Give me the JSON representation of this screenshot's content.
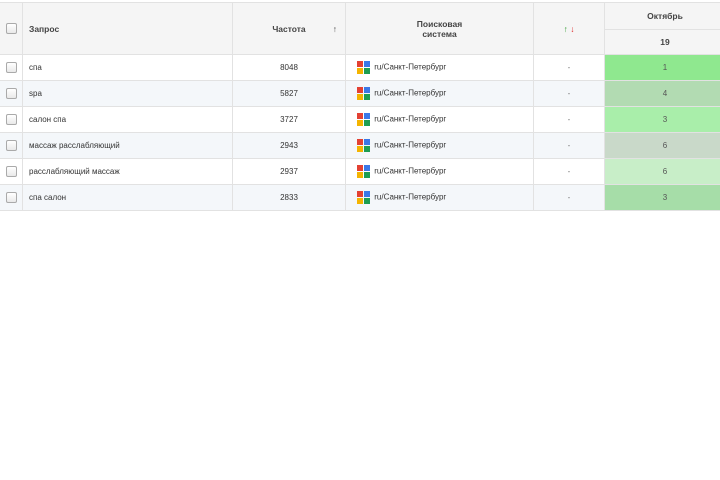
{
  "header": {
    "query": "Запрос",
    "frequency": "Частота",
    "sort_arrow": "↑",
    "engine_line1": "Поисковая",
    "engine_line2": "система",
    "dyn_up": "↑",
    "dyn_down": "↓",
    "month": "Октябрь",
    "day": "19"
  },
  "rows": [
    {
      "query": "спа",
      "frequency": "8048",
      "engine": "ru/Санкт-Петербург",
      "dynamics": "-",
      "position": "1",
      "pos_color": "#8fe88f"
    },
    {
      "query": "spa",
      "frequency": "5827",
      "engine": "ru/Санкт-Петербург",
      "dynamics": "-",
      "position": "4",
      "pos_color": "#b2dbb2"
    },
    {
      "query": "салон спа",
      "frequency": "3727",
      "engine": "ru/Санкт-Петербург",
      "dynamics": "-",
      "position": "3",
      "pos_color": "#a9eeaa"
    },
    {
      "query": "массаж расслабляющий",
      "frequency": "2943",
      "engine": "ru/Санкт-Петербург",
      "dynamics": "-",
      "position": "6",
      "pos_color": "#c9d9c9"
    },
    {
      "query": "расслабляющий массаж",
      "frequency": "2937",
      "engine": "ru/Санкт-Петербург",
      "dynamics": "-",
      "position": "6",
      "pos_color": "#c8eec8"
    },
    {
      "query": "спа салон",
      "frequency": "2833",
      "engine": "ru/Санкт-Петербург",
      "dynamics": "-",
      "position": "3",
      "pos_color": "#a6dda8"
    }
  ]
}
